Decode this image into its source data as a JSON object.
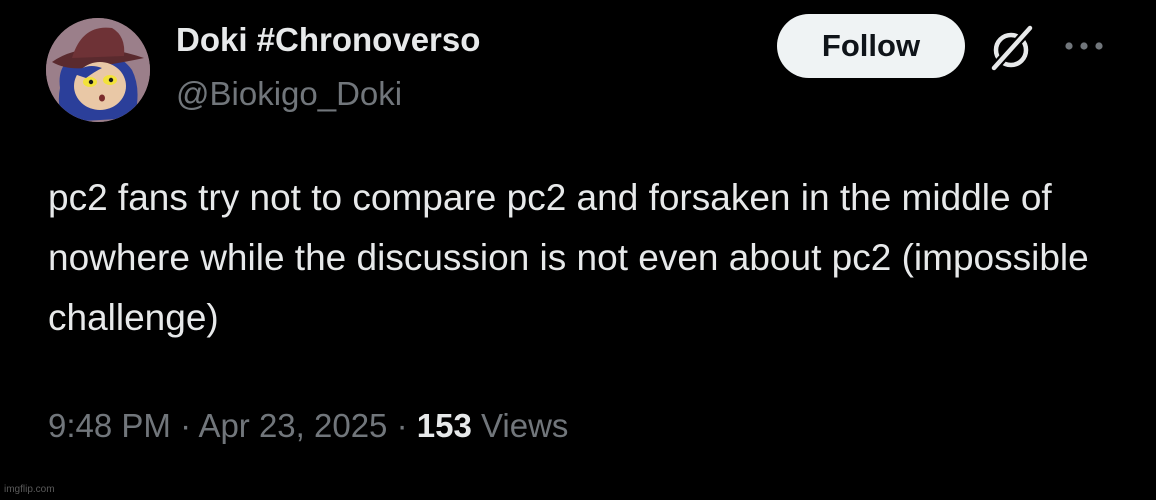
{
  "tweet": {
    "display_name": "Doki #Chronoverso",
    "handle": "@Biokigo_Doki",
    "follow_label": "Follow",
    "text": "pc2 fans try not to compare pc2 and forsaken in the middle of nowhere while the discussion is not even about pc2 (impossible challenge)",
    "time": "9:48 PM",
    "separator": "·",
    "date": "Apr 23, 2025",
    "views_count": "153",
    "views_label": "Views"
  },
  "icons": {
    "avatar": "character-avatar",
    "grok": "grok-icon",
    "more": "more-dots-icon"
  },
  "colors": {
    "background": "#000000",
    "primary_text": "#e7e9ea",
    "secondary_text": "#71767b",
    "follow_bg": "#eff3f4",
    "follow_text": "#0f1419"
  },
  "watermark": "imgflip.com"
}
